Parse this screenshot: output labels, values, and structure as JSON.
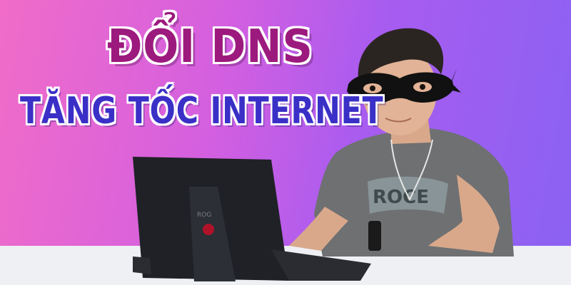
{
  "headline": {
    "line1": "ĐỔI DNS",
    "line2": "TĂNG TỐC INTERNET"
  },
  "laptop": {
    "brand": "ROG"
  },
  "shirt": {
    "print": "ROCE"
  },
  "colors": {
    "background_left": "#f06cc8",
    "background_right": "#8a62f2",
    "headline1": "#9c1a7d",
    "headline2": "#3a2fc6",
    "mask": "#111111",
    "laptop": "#1f2126",
    "shirt": "#6e7072",
    "desk": "#eef0f4"
  }
}
